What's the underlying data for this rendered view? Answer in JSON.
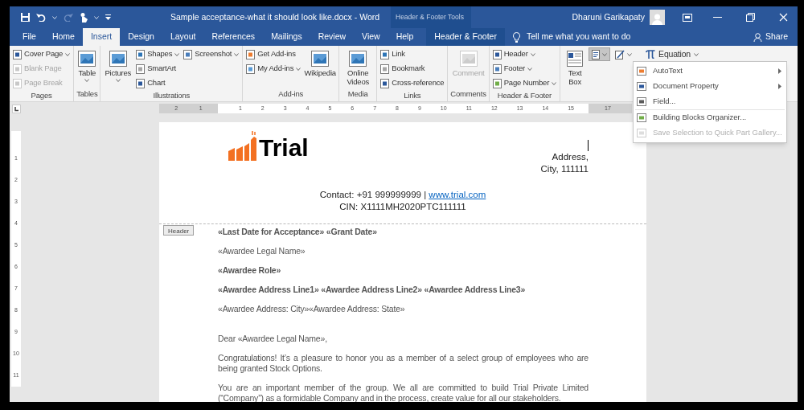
{
  "title_bar": {
    "document_title": "Sample acceptance-what it should look like.docx  -  Word",
    "context_label": "Header & Footer Tools",
    "user_name": "Dharuni  Garikapaty"
  },
  "tabs": [
    {
      "label": "File",
      "selected": false,
      "kind": "normal"
    },
    {
      "label": "Home",
      "selected": false,
      "kind": "normal"
    },
    {
      "label": "Insert",
      "selected": true,
      "kind": "normal"
    },
    {
      "label": "Design",
      "selected": false,
      "kind": "normal"
    },
    {
      "label": "Layout",
      "selected": false,
      "kind": "normal"
    },
    {
      "label": "References",
      "selected": false,
      "kind": "normal"
    },
    {
      "label": "Mailings",
      "selected": false,
      "kind": "normal"
    },
    {
      "label": "Review",
      "selected": false,
      "kind": "normal"
    },
    {
      "label": "View",
      "selected": false,
      "kind": "normal"
    },
    {
      "label": "Help",
      "selected": false,
      "kind": "normal"
    },
    {
      "label": "Header & Footer",
      "selected": false,
      "kind": "context"
    }
  ],
  "tell_me": {
    "placeholder": "Tell me what you want to do"
  },
  "share": "Share",
  "ribbon_groups": [
    {
      "name": "Pages",
      "columns": [
        [
          {
            "label": "Cover Page",
            "kind": "small",
            "disabled": false,
            "dropdown": true
          },
          {
            "label": "Blank Page",
            "kind": "small",
            "disabled": true,
            "dropdown": false
          },
          {
            "label": "Page Break",
            "kind": "small",
            "disabled": true,
            "dropdown": false
          }
        ]
      ]
    },
    {
      "name": "Tables",
      "columns": [
        [
          {
            "label": "Table",
            "kind": "large",
            "disabled": false,
            "dropdown": true
          }
        ]
      ]
    },
    {
      "name": "Illustrations",
      "columns": [
        [
          {
            "label": "Pictures",
            "kind": "large",
            "disabled": false,
            "dropdown": true
          }
        ],
        [
          {
            "label": "Shapes",
            "kind": "small",
            "disabled": false,
            "dropdown": true
          },
          {
            "label": "SmartArt",
            "kind": "small",
            "disabled": false,
            "dropdown": false
          },
          {
            "label": "Chart",
            "kind": "small",
            "disabled": false,
            "dropdown": false
          }
        ],
        [
          {
            "label": "Screenshot",
            "kind": "small",
            "disabled": false,
            "dropdown": true
          }
        ]
      ]
    },
    {
      "name": "Add-ins",
      "columns": [
        [
          {
            "label": "Get Add-ins",
            "kind": "small",
            "disabled": false,
            "dropdown": false
          },
          {
            "label": "My Add-ins",
            "kind": "small",
            "disabled": false,
            "dropdown": true
          }
        ],
        [
          {
            "label": "Wikipedia",
            "kind": "large",
            "disabled": false,
            "dropdown": false
          }
        ]
      ]
    },
    {
      "name": "Media",
      "columns": [
        [
          {
            "label": "Online Videos",
            "kind": "large",
            "disabled": false,
            "dropdown": false
          }
        ]
      ]
    },
    {
      "name": "Links",
      "columns": [
        [
          {
            "label": "Link",
            "kind": "small",
            "disabled": false,
            "dropdown": false
          },
          {
            "label": "Bookmark",
            "kind": "small",
            "disabled": false,
            "dropdown": false
          },
          {
            "label": "Cross-reference",
            "kind": "small",
            "disabled": false,
            "dropdown": false
          }
        ]
      ]
    },
    {
      "name": "Comments",
      "columns": [
        [
          {
            "label": "Comment",
            "kind": "large",
            "disabled": true,
            "dropdown": false
          }
        ]
      ]
    },
    {
      "name": "Header & Footer",
      "columns": [
        [
          {
            "label": "Header",
            "kind": "small",
            "disabled": false,
            "dropdown": true
          },
          {
            "label": "Footer",
            "kind": "small",
            "disabled": false,
            "dropdown": true
          },
          {
            "label": "Page Number",
            "kind": "small",
            "disabled": false,
            "dropdown": true
          }
        ]
      ]
    }
  ],
  "text_group": {
    "text_box": "Text Box",
    "equation": "Equation",
    "quick_parts_pressed": true
  },
  "quick_parts_menu": [
    {
      "label": "AutoText",
      "submenu": true,
      "disabled": false
    },
    {
      "label": "Document Property",
      "submenu": true,
      "disabled": false
    },
    {
      "label": "Field...",
      "submenu": false,
      "disabled": false
    },
    {
      "label": "Building Blocks Organizer...",
      "submenu": false,
      "disabled": false
    },
    {
      "label": "Save Selection to Quick Part Gallery...",
      "submenu": false,
      "disabled": true
    }
  ],
  "ruler": {
    "left_labels": [
      "2",
      "1"
    ],
    "page_labels": [
      "1",
      "2",
      "3",
      "4",
      "5",
      "6",
      "7",
      "8",
      "9",
      "10",
      "11",
      "12",
      "13",
      "14",
      "15"
    ],
    "right_labels": [
      "17"
    ],
    "vertical_labels": [
      "1",
      "2",
      "3",
      "4",
      "5",
      "6",
      "7",
      "8",
      "9",
      "10",
      "11"
    ]
  },
  "header": {
    "logo_text": "Trial",
    "address_lines": [
      "Address,",
      "City, 111111"
    ],
    "contact": "Contact: +91 999999999 | ",
    "website": "www.trial.com",
    "cin": "CIN: X1111MH2020PTC111111",
    "tag": "Header"
  },
  "body": [
    {
      "text": "«Last Date for Acceptance»  «Grant Date»",
      "bold": true
    },
    {
      "text": "«Awardee Legal Name»",
      "bold": false
    },
    {
      "text": "«Awardee Role»",
      "bold": true
    },
    {
      "text": "«Awardee Address Line1» «Awardee Address Line2» «Awardee Address Line3»",
      "bold": true
    },
    {
      "text": "«Awardee Address: City»«Awardee Address: State»",
      "bold": false
    },
    {
      "text": "Dear «Awardee Legal Name»,",
      "bold": false,
      "space_before": true
    },
    {
      "text": "Congratulations! It’s a pleasure to honor you as a member of a select group of employees who are being granted Stock Options.",
      "bold": false
    },
    {
      "text": "You are an important member of the group. We all are committed to build Trial Private Limited (“Company”) as a formidable Company and in the process, create value for all our stakeholders.",
      "bold": false
    }
  ]
}
